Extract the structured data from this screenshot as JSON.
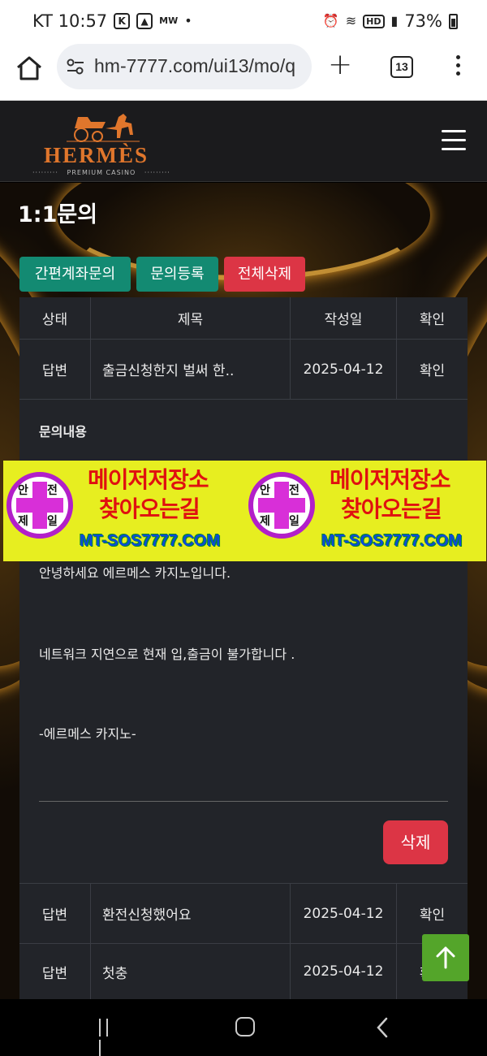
{
  "status_bar": {
    "carrier_time": "KT 10:57",
    "app_badge": "MW",
    "battery": "73%"
  },
  "browser": {
    "url": "hm-7777.com/ui13/mo/q",
    "tab_count": "13"
  },
  "site": {
    "brand": "HERMÈS",
    "tagline": "PREMIUM CASINO"
  },
  "page": {
    "title": "1:1문의",
    "buttons": {
      "account_inquiry": "간편계좌문의",
      "new_inquiry": "문의등록",
      "delete_all": "전체삭제"
    }
  },
  "table": {
    "headers": [
      "상태",
      "제목",
      "작성일",
      "확인"
    ],
    "rows": [
      {
        "status": "답변",
        "title": "출금신청한지 벌써 한..",
        "date": "2025-04-12",
        "confirm": "확인"
      },
      {
        "status": "답변",
        "title": "환전신청했어요",
        "date": "2025-04-12",
        "confirm": "확인"
      },
      {
        "status": "답변",
        "title": "첫충",
        "date": "2025-04-12",
        "confirm": "확인"
      }
    ]
  },
  "detail": {
    "label": "문의내용",
    "lines": [
      "안녕하세요 에르메스 카지노입니다.",
      "네트워크 지연으로 현재 입,출금이 불가합니다 .",
      "-에르메스 카지노-"
    ],
    "delete_label": "삭제"
  },
  "banner": {
    "badge_chars": [
      "안",
      "전",
      "제",
      "일"
    ],
    "line1": "메이저저장소",
    "line2": "찾아오는길",
    "line3": "MT-SOS7777.COM"
  },
  "colors": {
    "teal": "#138a72",
    "red": "#dc3545",
    "panel": "#222429",
    "brand_orange": "#e0762c",
    "scroll_green": "#54a52a"
  }
}
